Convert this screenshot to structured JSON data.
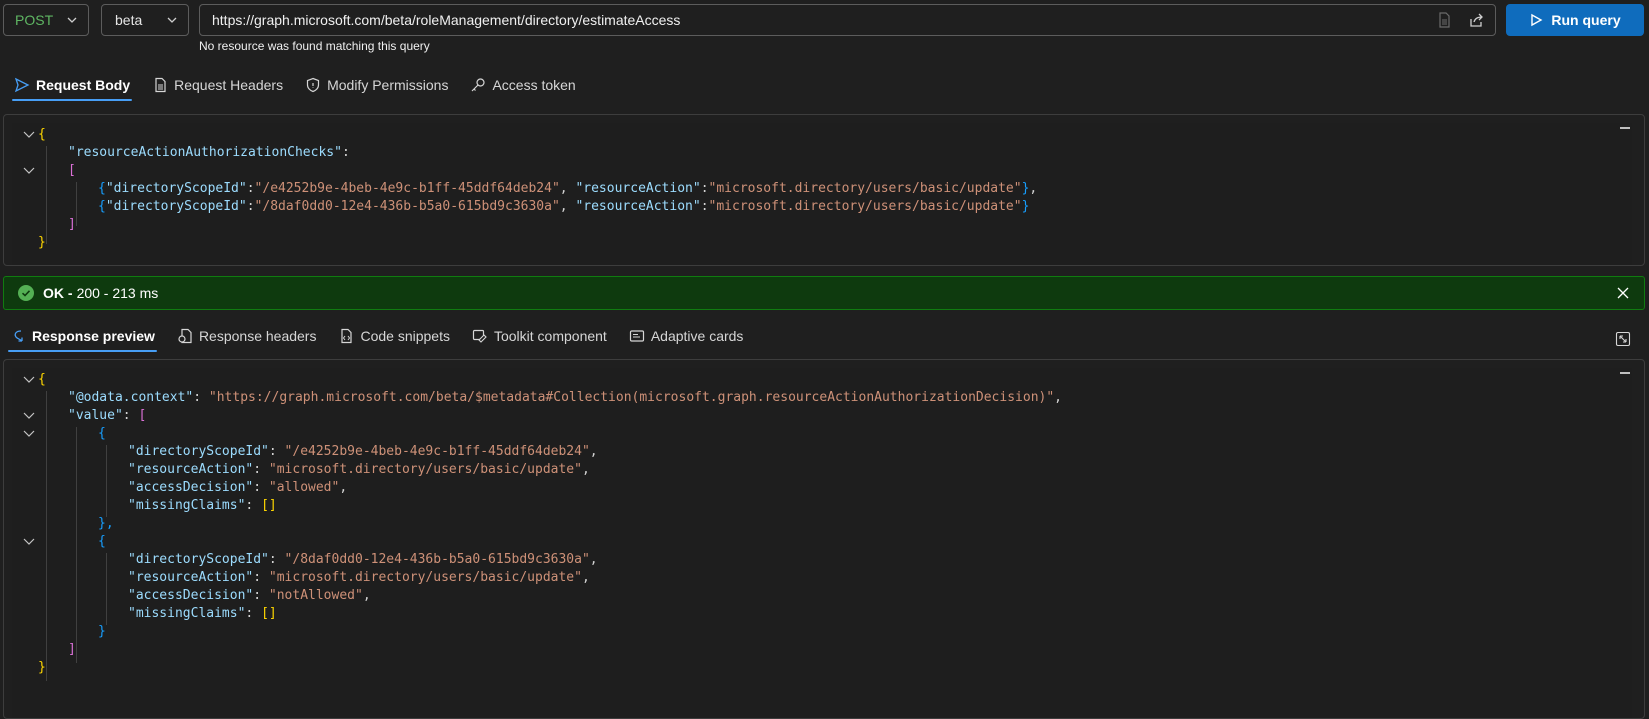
{
  "topbar": {
    "method": "POST",
    "version": "beta",
    "url": "https://graph.microsoft.com/beta/roleManagement/directory/estimateAccess",
    "url_hint": "No resource was found matching this query",
    "run_label": "Run query"
  },
  "request_tabs": [
    {
      "label": "Request Body",
      "icon": "send-icon",
      "active": true
    },
    {
      "label": "Request Headers",
      "icon": "document-icon",
      "active": false
    },
    {
      "label": "Modify Permissions",
      "icon": "shield-icon",
      "active": false
    },
    {
      "label": "Access token",
      "icon": "key-icon",
      "active": false
    }
  ],
  "request_body": {
    "l0": "{",
    "l1_key": "\"resourceActionAuthorizationChecks\"",
    "l1_colon": ":",
    "l2": "[",
    "l3_open": "{",
    "l3_k1": "\"directoryScopeId\"",
    "l3_v1": "\"/e4252b9e-4beb-4e9c-b1ff-45ddf64deb24\"",
    "l3_k2": "\"resourceAction\"",
    "l3_v2": "\"microsoft.directory/users/basic/update\"",
    "l3_close": "},",
    "l4_open": "{",
    "l4_k1": "\"directoryScopeId\"",
    "l4_v1": "\"/8daf0dd0-12e4-436b-b5a0-615bd9c3630a\"",
    "l4_k2": "\"resourceAction\"",
    "l4_v2": "\"microsoft.directory/users/basic/update\"",
    "l4_close": "}",
    "l5": "]",
    "l6": "}"
  },
  "status": {
    "ok": "OK -",
    "detail": "200 - 213 ms"
  },
  "response_tabs": [
    {
      "label": "Response preview",
      "icon": "preview-icon",
      "active": true
    },
    {
      "label": "Response headers",
      "icon": "document-icon",
      "active": false
    },
    {
      "label": "Code snippets",
      "icon": "code-icon",
      "active": false
    },
    {
      "label": "Toolkit component",
      "icon": "toolkit-icon",
      "active": false
    },
    {
      "label": "Adaptive cards",
      "icon": "card-icon",
      "active": false
    }
  ],
  "response_body": {
    "open": "{",
    "ctx_key": "\"@odata.context\"",
    "ctx_val": "\"https://graph.microsoft.com/beta/$metadata#Collection(microsoft.graph.resourceActionAuthorizationDecision)\"",
    "value_key": "\"value\"",
    "arr_open": "[",
    "items": [
      {
        "scope_key": "\"directoryScopeId\"",
        "scope_val": "\"/e4252b9e-4beb-4e9c-b1ff-45ddf64deb24\"",
        "action_key": "\"resourceAction\"",
        "action_val": "\"microsoft.directory/users/basic/update\"",
        "decision_key": "\"accessDecision\"",
        "decision_val": "\"allowed\"",
        "claims_key": "\"missingClaims\"",
        "claims_val": "[]",
        "close": "},"
      },
      {
        "scope_key": "\"directoryScopeId\"",
        "scope_val": "\"/8daf0dd0-12e4-436b-b5a0-615bd9c3630a\"",
        "action_key": "\"resourceAction\"",
        "action_val": "\"microsoft.directory/users/basic/update\"",
        "decision_key": "\"accessDecision\"",
        "decision_val": "\"notAllowed\"",
        "claims_key": "\"missingClaims\"",
        "claims_val": "[]",
        "close": "}"
      }
    ],
    "arr_close": "]",
    "close": "}"
  },
  "colors": {
    "accent": "#0f6cbd",
    "success_bg": "#0e3a0e",
    "success_border": "#107c10",
    "method_post": "#5fb663"
  }
}
